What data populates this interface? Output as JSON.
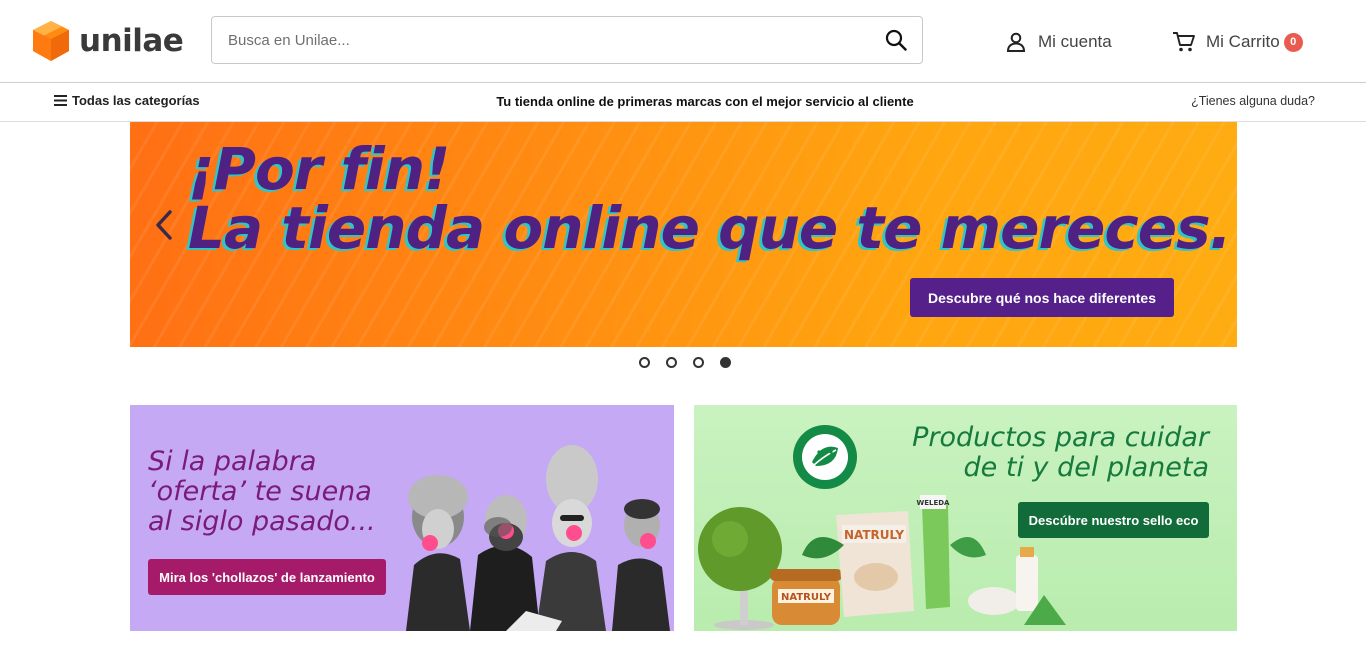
{
  "header": {
    "logo_text": "unilae",
    "search": {
      "placeholder": "Busca en Unilae..."
    },
    "account_label": "Mi cuenta",
    "cart_label": "Mi Carrito",
    "cart_count": "0"
  },
  "subnav": {
    "categories_label": "Todas las categorías",
    "tagline": "Tu tienda online de primeras marcas con el mejor servicio al cliente",
    "help_label": "¿Tienes alguna duda?"
  },
  "hero": {
    "line1": "¡Por fin!",
    "line2": "La tienda online que te mereces.",
    "cta_label": "Descubre qué nos hace diferentes",
    "slide_count": 4,
    "active_slide": 4
  },
  "promos": {
    "left": {
      "line1": "Si la palabra",
      "line2": "‘oferta’ te suena",
      "line3": "al siglo pasado...",
      "cta_label": "Mira los 'chollazos' de lanzamiento"
    },
    "right": {
      "line1": "Productos para cuidar",
      "line2": "de ti y del planeta",
      "cta_label": "Descúbre nuestro sello eco",
      "product_label_1": "NATRULY",
      "product_label_2": "NATRULY",
      "product_label_3": "WELEDA"
    }
  },
  "colors": {
    "brand_orange": "#ff8a12",
    "hero_text": "#4e2183",
    "hero_cta": "#55208a",
    "promo_left_bg": "#c6a9f5",
    "promo_left_cta": "#a51b6a",
    "promo_right_bg": "#c9f2c0",
    "promo_right_cta": "#126c3a",
    "cart_badge": "#e95b4f"
  },
  "icons": [
    "logo-box-icon",
    "search-icon",
    "user-icon",
    "cart-icon",
    "hamburger-icon",
    "chevron-left-icon",
    "eco-leaf-icon"
  ]
}
